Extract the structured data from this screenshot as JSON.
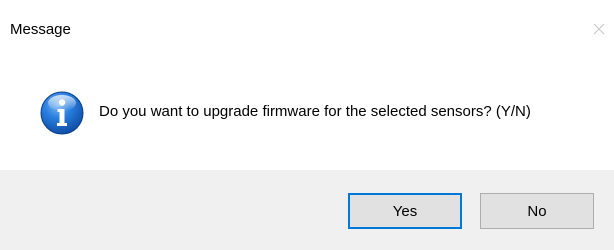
{
  "window": {
    "title": "Message",
    "close_icon": "close-icon"
  },
  "content": {
    "icon": "info-icon",
    "message": "Do you want to upgrade firmware for the selected sensors? (Y/N)"
  },
  "buttons": {
    "yes_label": "Yes",
    "no_label": "No"
  },
  "colors": {
    "footer_bg": "#f0f0f0",
    "button_bg": "#e1e1e1",
    "default_button_border": "#0078d7",
    "info_icon_blue": "#1c6fd0"
  }
}
